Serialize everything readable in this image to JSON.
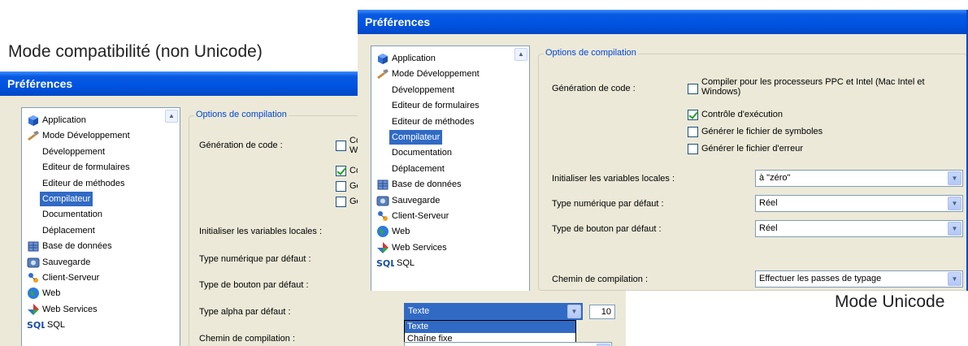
{
  "captions": {
    "compat": "Mode compatibilité (non Unicode)",
    "unicode": "Mode Unicode"
  },
  "win_compat": {
    "title": "Préférences",
    "nav": [
      {
        "label": "Application",
        "icon": "application-icon",
        "level": 0
      },
      {
        "label": "Mode Développement",
        "icon": "tools-icon",
        "level": 0
      },
      {
        "label": "Développement",
        "level": 1
      },
      {
        "label": "Editeur de formulaires",
        "level": 1
      },
      {
        "label": "Editeur de méthodes",
        "level": 1
      },
      {
        "label": "Compilateur",
        "level": 1,
        "selected": true
      },
      {
        "label": "Documentation",
        "level": 1
      },
      {
        "label": "Déplacement",
        "level": 1
      },
      {
        "label": "Base de données",
        "icon": "database-icon",
        "level": 0
      },
      {
        "label": "Sauvegarde",
        "icon": "backup-icon",
        "level": 0
      },
      {
        "label": "Client-Serveur",
        "icon": "client-server-icon",
        "level": 0
      },
      {
        "label": "Web",
        "icon": "globe-icon",
        "level": 0
      },
      {
        "label": "Web Services",
        "icon": "web-services-icon",
        "level": 0
      },
      {
        "label": "SQL",
        "icon": "sql-icon",
        "level": 0
      }
    ],
    "section_title": "Options de compilation",
    "code_gen_label": "Génération de code :",
    "cb_ppc_text": "Co",
    "cb_ppc_text2": "W",
    "cb_runtime_text": "Co",
    "cb_symbols_text": "Gé",
    "cb_errors_text": "Ge",
    "init_vars_label": "Initialiser les variables locales :",
    "numeric_type_label": "Type numérique par défaut :",
    "button_type_label": "Type de bouton par défaut :",
    "alpha_type_label": "Type alpha par défaut :",
    "alpha_type_value": "Texte",
    "alpha_length": "10",
    "alpha_options": [
      "Texte",
      "Chaîne fixe"
    ],
    "compile_path_label": "Chemin de compilation :"
  },
  "win_unicode": {
    "title": "Préférences",
    "nav": [
      {
        "label": "Application",
        "icon": "application-icon",
        "level": 0
      },
      {
        "label": "Mode Développement",
        "icon": "tools-icon",
        "level": 0
      },
      {
        "label": "Développement",
        "level": 1
      },
      {
        "label": "Editeur de formulaires",
        "level": 1
      },
      {
        "label": "Editeur de méthodes",
        "level": 1
      },
      {
        "label": "Compilateur",
        "level": 1,
        "selected": true
      },
      {
        "label": "Documentation",
        "level": 1
      },
      {
        "label": "Déplacement",
        "level": 1
      },
      {
        "label": "Base de données",
        "icon": "database-icon",
        "level": 0
      },
      {
        "label": "Sauvegarde",
        "icon": "backup-icon",
        "level": 0
      },
      {
        "label": "Client-Serveur",
        "icon": "client-server-icon",
        "level": 0
      },
      {
        "label": "Web",
        "icon": "globe-icon",
        "level": 0
      },
      {
        "label": "Web Services",
        "icon": "web-services-icon",
        "level": 0
      },
      {
        "label": "SQL",
        "icon": "sql-icon",
        "level": 0
      }
    ],
    "section_title": "Options de compilation",
    "code_gen_label": "Génération de code :",
    "cb_ppc_line1": "Compiler pour les processeurs PPC et Intel (Mac Intel et",
    "cb_ppc_line2": "Windows)",
    "cb_ppc_checked": false,
    "cb_runtime": "Contrôle d'exécution",
    "cb_runtime_checked": true,
    "cb_symbols": "Générer le fichier de symboles",
    "cb_symbols_checked": false,
    "cb_errors": "Générer le fichier d'erreur",
    "cb_errors_checked": false,
    "init_vars_label": "Initialiser les variables locales :",
    "init_vars_value": "à \"zéro\"",
    "numeric_type_label": "Type numérique par défaut :",
    "numeric_type_value": "Réel",
    "button_type_label": "Type de bouton par défaut :",
    "button_type_value": "Réel",
    "compile_path_label": "Chemin de compilation :",
    "compile_path_value": "Effectuer les passes de typage"
  },
  "colors": {
    "title_blue": "#0054e3",
    "selection": "#316ac5",
    "window_bg": "#ece9d8",
    "group_title": "#0046d5"
  }
}
